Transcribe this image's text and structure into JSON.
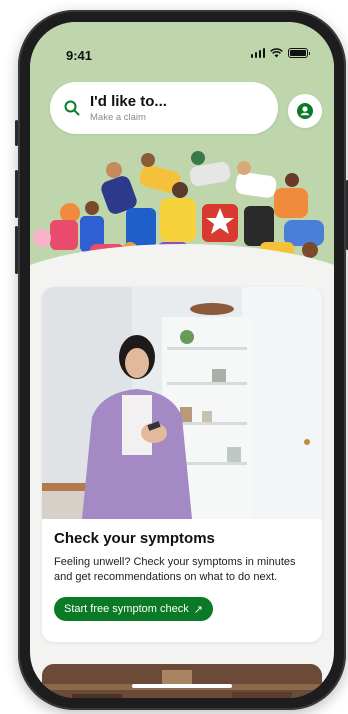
{
  "status_bar": {
    "time": "9:41"
  },
  "search": {
    "title": "I'd like to...",
    "subtitle": "Make a claim"
  },
  "card": {
    "title": "Check your symptoms",
    "description": "Feeling unwell? Check your symptoms in minutes and get recommendations on what to do next.",
    "cta_label": "Start free symptom check",
    "cta_arrow": "↗"
  },
  "icons": {
    "search": "search-icon",
    "profile": "profile-icon",
    "arrow": "arrow-up-right-icon"
  },
  "colors": {
    "hero_bg": "#bfd6ad",
    "brand_green": "#0a7a27",
    "page_bg": "#f3f4f2"
  }
}
